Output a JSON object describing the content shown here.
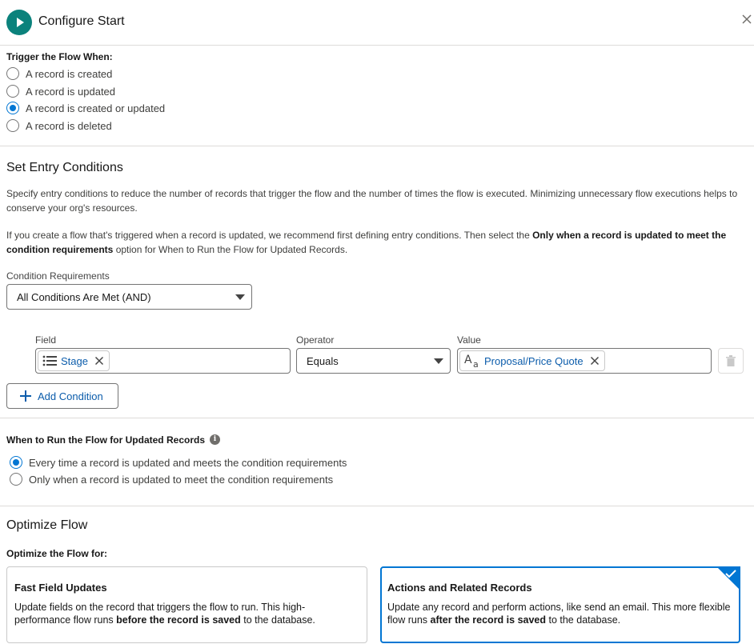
{
  "header": {
    "title": "Configure Start"
  },
  "trigger": {
    "label": "Trigger the Flow When:",
    "options": [
      {
        "label": "A record is created",
        "checked": false
      },
      {
        "label": "A record is updated",
        "checked": false
      },
      {
        "label": "A record is created or updated",
        "checked": true
      },
      {
        "label": "A record is deleted",
        "checked": false
      }
    ]
  },
  "entry": {
    "heading": "Set Entry Conditions",
    "description": "Specify entry conditions to reduce the number of records that trigger the flow and the number of times the flow is executed. Minimizing unnecessary flow executions helps to conserve your org's resources.",
    "tip_prefix": "If you create a flow that's triggered when a record is updated, we recommend first defining entry conditions. Then select the ",
    "tip_bold": "Only when a record is updated to meet the condition requirements",
    "tip_suffix": " option for When to Run the Flow for Updated Records.",
    "condition_requirements_label": "Condition Requirements",
    "condition_requirements_value": "All Conditions Are Met (AND)",
    "field_label": "Field",
    "operator_label": "Operator",
    "value_label": "Value",
    "condition": {
      "field": "Stage",
      "operator": "Equals",
      "value": "Proposal/Price Quote"
    },
    "add_condition_label": "Add Condition"
  },
  "run": {
    "label": "When to Run the Flow for Updated Records",
    "options": [
      {
        "label": "Every time a record is updated and meets the condition requirements",
        "checked": true
      },
      {
        "label": "Only when a record is updated to meet the condition requirements",
        "checked": false
      }
    ]
  },
  "optimize": {
    "heading": "Optimize Flow",
    "label": "Optimize the Flow for:",
    "cards": [
      {
        "title": "Fast Field Updates",
        "desc_prefix": "Update fields on the record that triggers the flow to run. This high-performance flow runs ",
        "desc_bold": "before the record is saved",
        "desc_suffix": " to the database.",
        "selected": false
      },
      {
        "title": "Actions and Related Records",
        "desc_prefix": "Update any record and perform actions, like send an email. This more flexible flow runs ",
        "desc_bold": "after the record is saved",
        "desc_suffix": " to the database.",
        "selected": true
      }
    ]
  },
  "icons": {
    "start": "play-icon",
    "close": "close-icon",
    "picklist": "picklist-icon",
    "text": "text-type-icon",
    "remove": "remove-pill-icon",
    "trash": "trash-icon",
    "add": "plus-icon",
    "info": "info-icon",
    "check": "checkmark-icon"
  },
  "colors": {
    "brand": "#0176d3",
    "start_icon_bg": "#0b827c",
    "link": "#0b5cab"
  }
}
